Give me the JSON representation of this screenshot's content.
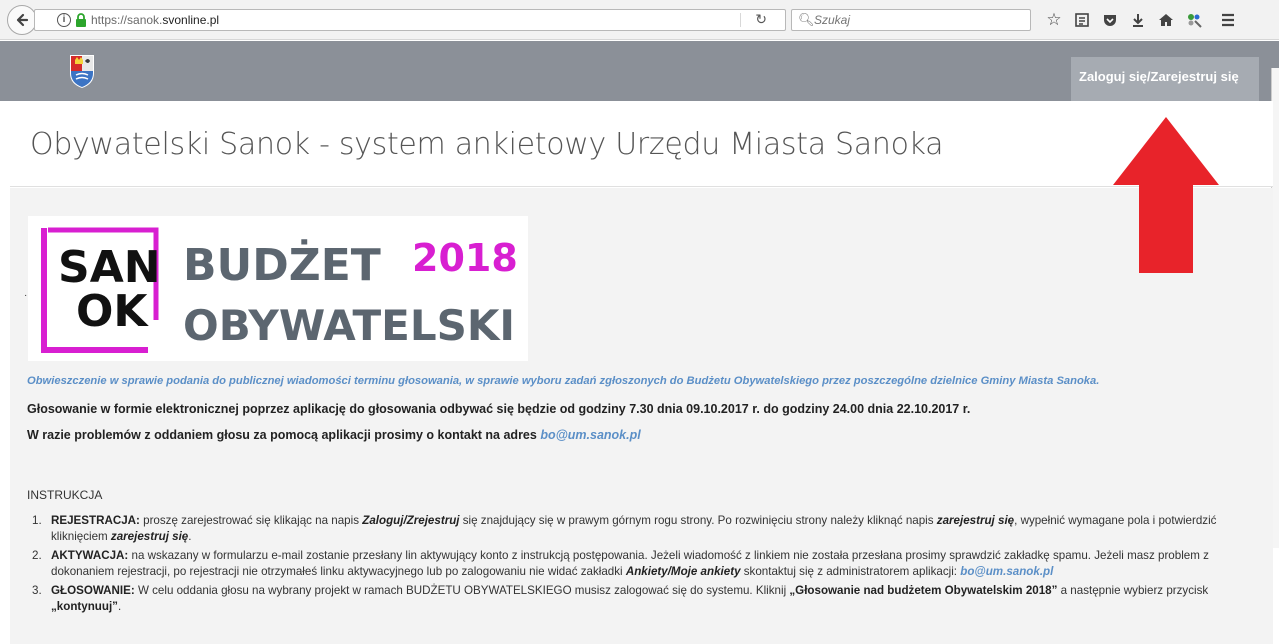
{
  "browser": {
    "url_prefix": "https://sanok.",
    "url_domain": "svonline.pl",
    "search_placeholder": "Szukaj",
    "info_glyph": "i",
    "icons": [
      "back-arrow-icon",
      "info-icon",
      "lock-icon",
      "reload-icon",
      "search-icon",
      "bookmark-star-icon",
      "reading-list-icon",
      "pocket-icon",
      "download-icon",
      "home-icon",
      "extensions-icon",
      "menu-icon"
    ]
  },
  "header": {
    "login_label": "Zaloguj się/Zarejestruj się"
  },
  "page": {
    "title": "Obywatelski Sanok - system ankietowy Urzędu Miasta Sanoka",
    "banner": {
      "sanok_top": "SAN",
      "sanok_bottom": "OK",
      "budzet": "BUDŻET",
      "year": "2018",
      "obywatelski": "OBYWATELSKI"
    },
    "notice_link": "Obwieszczenie w  sprawie podania do publicznej wiadomości terminu głosowania, w sprawie wyboru zadań zgłoszonych do Budżetu Obywatelskiego przez poszczególne dzielnice Gminy Miasta Sanoka.",
    "voting_info": "Głosowanie w formie elektronicznej poprzez aplikację do głosowania odbywać się będzie od godziny 7.30 dnia 09.10.2017 r. do godziny 24.00 dnia 22.10.2017 r.",
    "contact_text": "W razie problemów z oddaniem głosu za pomocą aplikacji prosimy o kontakt na adres ",
    "contact_email": "bo@um.sanok.pl",
    "instructions_heading": "INSTRUKCJA",
    "instructions": [
      {
        "num": "1.",
        "label": "REJESTRACJA:",
        "t1": " proszę zarejestrować się klikając na napis ",
        "e1": "Zaloguj/Zrejestruj",
        "t2": " się znajdujący się w prawym górnym rogu strony. Po rozwinięciu strony należy kliknąć napis ",
        "e2": "zarejestruj się",
        "t3": ", wypełnić wymagane pola i potwierdzić kliknięciem ",
        "e3": "zarejestruj się",
        "t4": "."
      },
      {
        "num": "2.",
        "label": "AKTYWACJA:",
        "t1": " na wskazany w formularzu e-mail zostanie przesłany lin aktywujący konto z instrukcją postępowania. Jeżeli wiadomość z linkiem nie została przesłana prosimy sprawdzić zakładkę spamu. Jeżeli masz problem z dokonaniem rejestracji, po rejestracji nie otrzymałeś linku aktywacyjnego lub po zalogowaniu nie widać zakładki ",
        "e1": "Ankiety/Moje ankiety",
        "t2": " skontaktuj się z administratorem aplikacji: ",
        "email": "bo@um.sanok.pl"
      },
      {
        "num": "3.",
        "label": "GŁOSOWANIE:",
        "t1": " W celu oddania głosu na wybrany projekt w ramach BUDŻETU OBYWATELSKIEGO musisz zalogować się do systemu. Kliknij ",
        "b1": "„Głosowanie nad budżetem Obywatelskim 2018”",
        "t2": " a następnie wybierz przycisk ",
        "b2": "„kontynuuj”",
        "t3": "."
      }
    ]
  },
  "colors": {
    "header_bg": "#8b9098",
    "login_bg": "#a6abb2",
    "link": "#5b8fc7",
    "arrow": "#e8232a",
    "banner_magenta": "#d81fd1",
    "banner_gray": "#5c6670"
  }
}
